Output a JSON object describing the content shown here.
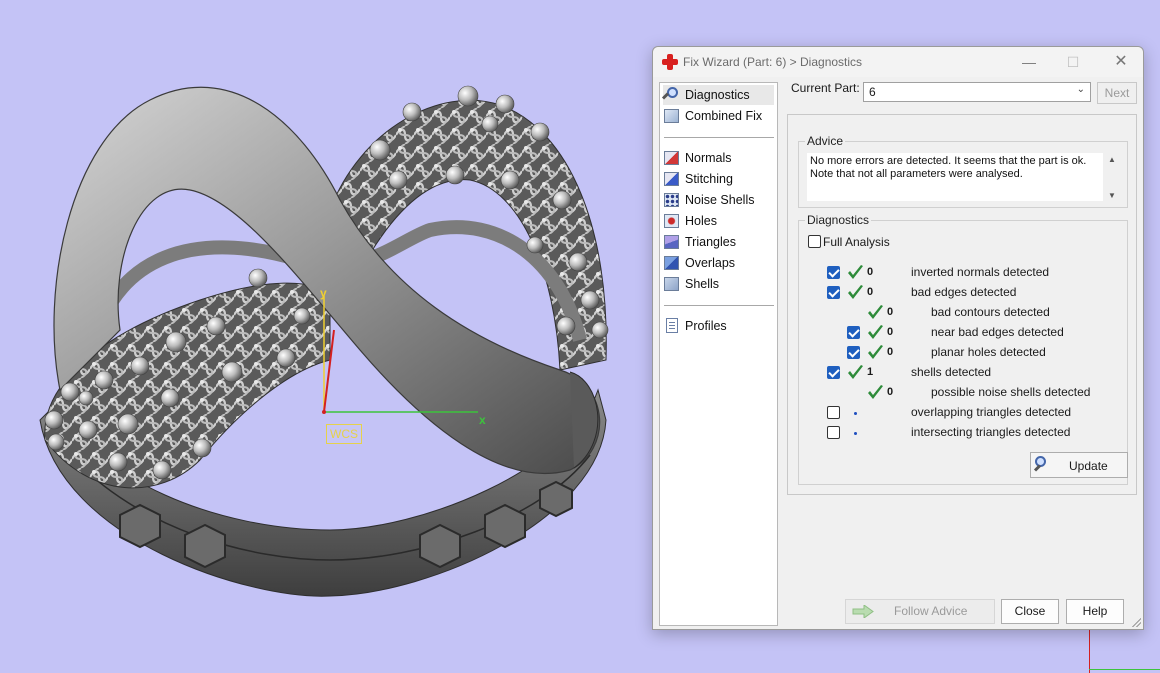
{
  "viewport": {
    "wcs_label": "WCS",
    "axis_x": "x",
    "axis_y": "y",
    "background_color": "#c4c3f6"
  },
  "dialog": {
    "title": "Fix Wizard (Part: 6) > Diagnostics",
    "nav": {
      "items": [
        {
          "label": "Diagnostics",
          "icon": "magnifier-icon",
          "selected": true
        },
        {
          "label": "Combined Fix",
          "icon": "combined-fix-icon"
        },
        {
          "label": "Normals",
          "icon": "normals-icon"
        },
        {
          "label": "Stitching",
          "icon": "stitching-icon"
        },
        {
          "label": "Noise Shells",
          "icon": "noise-shells-icon"
        },
        {
          "label": "Holes",
          "icon": "holes-icon"
        },
        {
          "label": "Triangles",
          "icon": "triangles-icon"
        },
        {
          "label": "Overlaps",
          "icon": "overlaps-icon"
        },
        {
          "label": "Shells",
          "icon": "shells-icon"
        },
        {
          "label": "Profiles",
          "icon": "profiles-icon"
        }
      ]
    },
    "current_part": {
      "label": "Current Part:",
      "value": "6"
    },
    "next_label": "Next",
    "advice": {
      "title": "Advice",
      "text": "No more errors are detected. It seems that the part is ok. Note that not all parameters were analysed."
    },
    "diagnostics": {
      "title": "Diagnostics",
      "full_analysis_label": "Full Analysis",
      "full_analysis_checked": false,
      "rows": [
        {
          "checked": true,
          "count": "0",
          "label": "inverted normals detected",
          "indent": 0,
          "status": "ok"
        },
        {
          "checked": true,
          "count": "0",
          "label": "bad edges detected",
          "indent": 0,
          "status": "ok"
        },
        {
          "checked": null,
          "count": "0",
          "label": "bad contours detected",
          "indent": 1,
          "status": "ok"
        },
        {
          "checked": true,
          "count": "0",
          "label": "near bad edges detected",
          "indent": 1,
          "status": "ok"
        },
        {
          "checked": true,
          "count": "0",
          "label": "planar holes detected",
          "indent": 1,
          "status": "ok"
        },
        {
          "checked": true,
          "count": "1",
          "label": "shells detected",
          "indent": 0,
          "status": "ok"
        },
        {
          "checked": null,
          "count": "0",
          "label": "possible noise shells detected",
          "indent": 1,
          "status": "ok"
        },
        {
          "checked": false,
          "count": "",
          "label": "overlapping triangles detected",
          "indent": 0,
          "status": "pending"
        },
        {
          "checked": false,
          "count": "",
          "label": "intersecting triangles detected",
          "indent": 0,
          "status": "pending"
        }
      ],
      "update_label": "Update"
    },
    "buttons": {
      "follow_advice": "Follow Advice",
      "close": "Close",
      "help": "Help"
    },
    "colors": {
      "accent_check": "#1f5fbf",
      "ok_tick": "#2e8b3a"
    }
  }
}
